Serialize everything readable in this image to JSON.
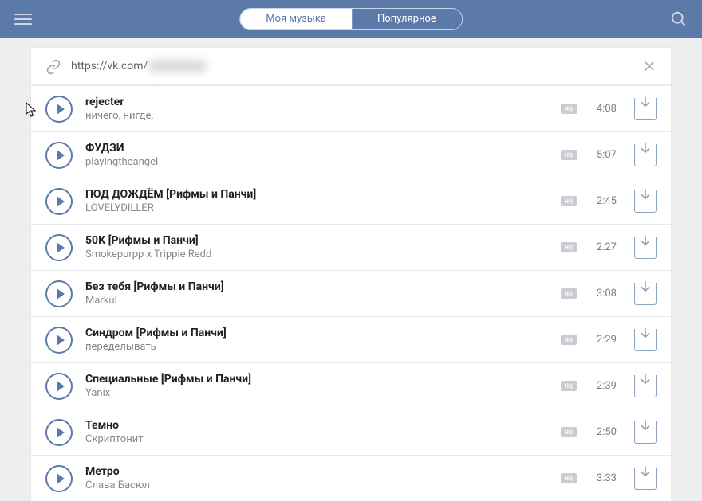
{
  "header": {
    "tabs": [
      {
        "label": "Моя музыка",
        "active": true
      },
      {
        "label": "Популярное",
        "active": false
      }
    ]
  },
  "url_bar": {
    "prefix": "https://vk.com/"
  },
  "tracks": [
    {
      "title": "rejecter",
      "artist": "ничего, нигде.",
      "duration": "4:08",
      "hq": true
    },
    {
      "title": "ФУДЗИ",
      "artist": "playingtheangel",
      "duration": "5:07",
      "hq": true
    },
    {
      "title": "ПОД ДОЖДЁМ [Рифмы и Панчи]",
      "artist": "LOVELYDILLER",
      "duration": "2:45",
      "hq": true
    },
    {
      "title": "50К [Рифмы и Панчи]",
      "artist": "Smokepurpp x Trippie Redd",
      "duration": "2:27",
      "hq": true
    },
    {
      "title": "Без тебя [Рифмы и Панчи]",
      "artist": "Markul",
      "duration": "3:08",
      "hq": true
    },
    {
      "title": "Синдром [Рифмы и Панчи]",
      "artist": "переделывать",
      "duration": "2:29",
      "hq": true
    },
    {
      "title": "Специальные [Рифмы и Панчи]",
      "artist": "Yanix",
      "duration": "2:39",
      "hq": true
    },
    {
      "title": "Темно",
      "artist": "Скриптонит",
      "duration": "2:50",
      "hq": true
    },
    {
      "title": "Метро",
      "artist": "Слава Басюл",
      "duration": "3:33",
      "hq": true
    }
  ]
}
